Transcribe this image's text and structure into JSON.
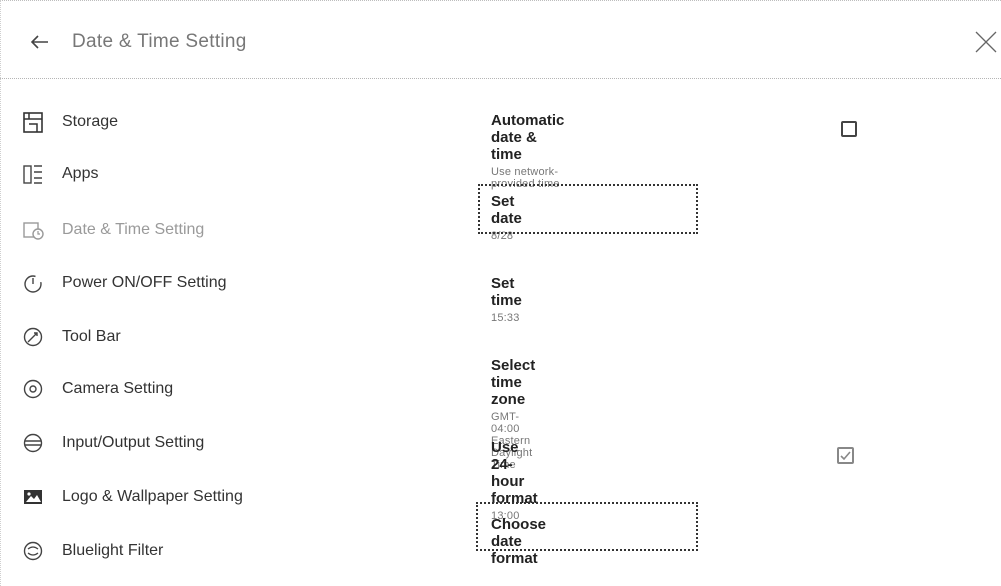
{
  "header": {
    "title": "Date & Time Setting"
  },
  "sidebar": {
    "items": [
      {
        "label": "Storage",
        "icon": "storage-icon"
      },
      {
        "label": "Apps",
        "icon": "apps-icon"
      },
      {
        "label": "Date & Time Setting",
        "icon": "calendar-clock-icon"
      },
      {
        "label": "Power ON/OFF Setting",
        "icon": "power-icon"
      },
      {
        "label": "Tool Bar",
        "icon": "toolbar-icon"
      },
      {
        "label": "Camera Setting",
        "icon": "camera-icon"
      },
      {
        "label": "Input/Output Setting",
        "icon": "input-output-icon"
      },
      {
        "label": "Logo & Wallpaper Setting",
        "icon": "wallpaper-icon"
      },
      {
        "label": "Bluelight Filter",
        "icon": "bluelight-icon"
      }
    ],
    "active_item": "Date & Time Setting"
  },
  "settings": {
    "auto_date_time": {
      "title": "Automatic date & time",
      "subtitle": "Use network-provided time",
      "checked": false
    },
    "set_date": {
      "title": "Set date",
      "value": "8/28"
    },
    "set_time": {
      "title": "Set time",
      "value": "15:33"
    },
    "time_zone": {
      "title": "Select time zone",
      "value": "GMT-04:00 Eastern Daylight Time"
    },
    "hour_format": {
      "title": "Use 24-hour format",
      "value": "13:00",
      "checked": true
    },
    "date_format": {
      "title": "Choose date format"
    }
  }
}
